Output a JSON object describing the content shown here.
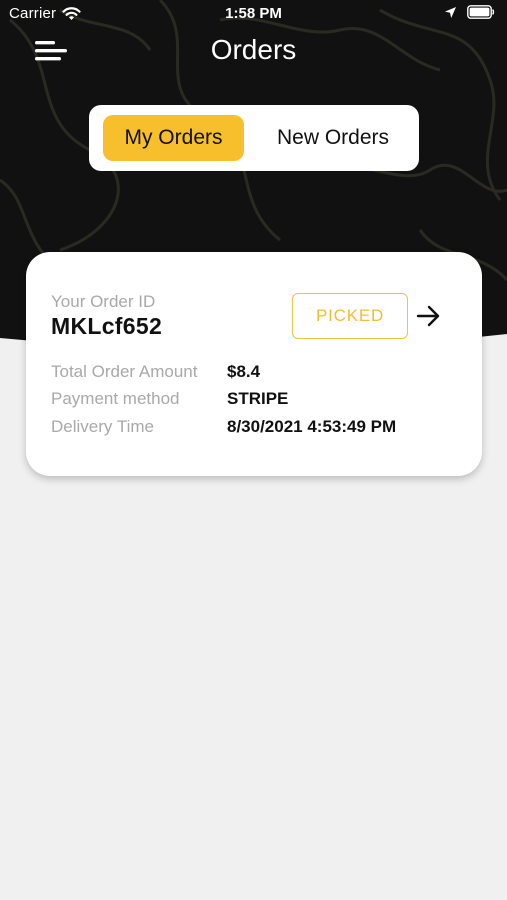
{
  "status_bar": {
    "carrier": "Carrier",
    "time": "1:58 PM",
    "icons": [
      "wifi-icon",
      "location-icon",
      "battery-icon"
    ]
  },
  "header": {
    "title": "Orders",
    "menu_icon": "menu-icon"
  },
  "tabs": [
    {
      "label": "My Orders",
      "active": true
    },
    {
      "label": "New Orders",
      "active": false
    }
  ],
  "orders": [
    {
      "id_label": "Your Order ID",
      "id": "MKLcf652",
      "status": "PICKED",
      "fields": [
        {
          "label": "Total Order Amount",
          "value": "$8.4"
        },
        {
          "label": "Payment method",
          "value": "STRIPE"
        },
        {
          "label": "Delivery Time",
          "value": "8/30/2021 4:53:49 PM"
        }
      ]
    }
  ],
  "colors": {
    "header_bg": "#111111",
    "accent": "#f6bf2b",
    "status_badge": "#f2bd35",
    "page_bg": "#f0f0f0"
  }
}
